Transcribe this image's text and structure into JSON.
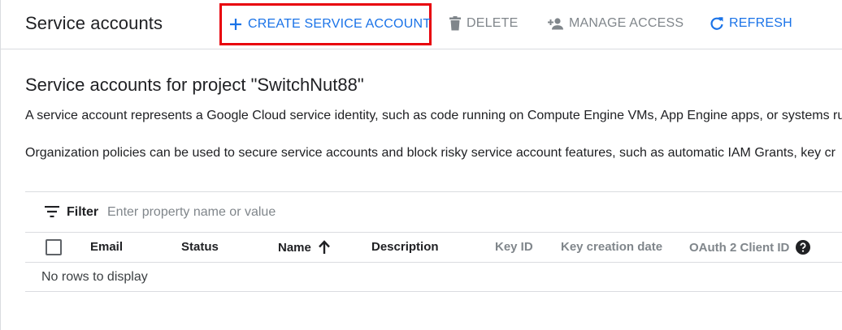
{
  "header": {
    "title": "Service accounts",
    "toolbar": {
      "create_label": "CREATE SERVICE ACCOUNT",
      "delete_label": "DELETE",
      "manage_label": "MANAGE ACCESS",
      "refresh_label": "REFRESH"
    }
  },
  "main": {
    "section_title": "Service accounts for project \"SwitchNut88\"",
    "description_1": "A service account represents a Google Cloud service identity, such as code running on Compute Engine VMs, App Engine apps, or systems ru",
    "description_2": "Organization policies can be used to secure service accounts and block risky service account features, such as automatic IAM Grants, key cr"
  },
  "table": {
    "filter_label": "Filter",
    "filter_placeholder": "Enter property name or value",
    "columns": {
      "email": "Email",
      "status": "Status",
      "name": "Name",
      "description": "Description",
      "key_id": "Key ID",
      "key_creation_date": "Key creation date",
      "oauth_client_id": "OAuth 2 Client ID"
    },
    "sort_column": "Name",
    "sort_direction": "ascending",
    "empty_message": "No rows to display"
  },
  "colors": {
    "accent": "#1a73e8",
    "disabled": "#80868b",
    "highlight_border": "#e8000b",
    "divider": "#dadce0"
  },
  "icons": {
    "create": "plus-icon",
    "delete": "trash-icon",
    "manage": "person-add-icon",
    "refresh": "refresh-icon",
    "filter": "filter-icon",
    "sort": "arrow-up-icon",
    "help": "help-icon"
  }
}
